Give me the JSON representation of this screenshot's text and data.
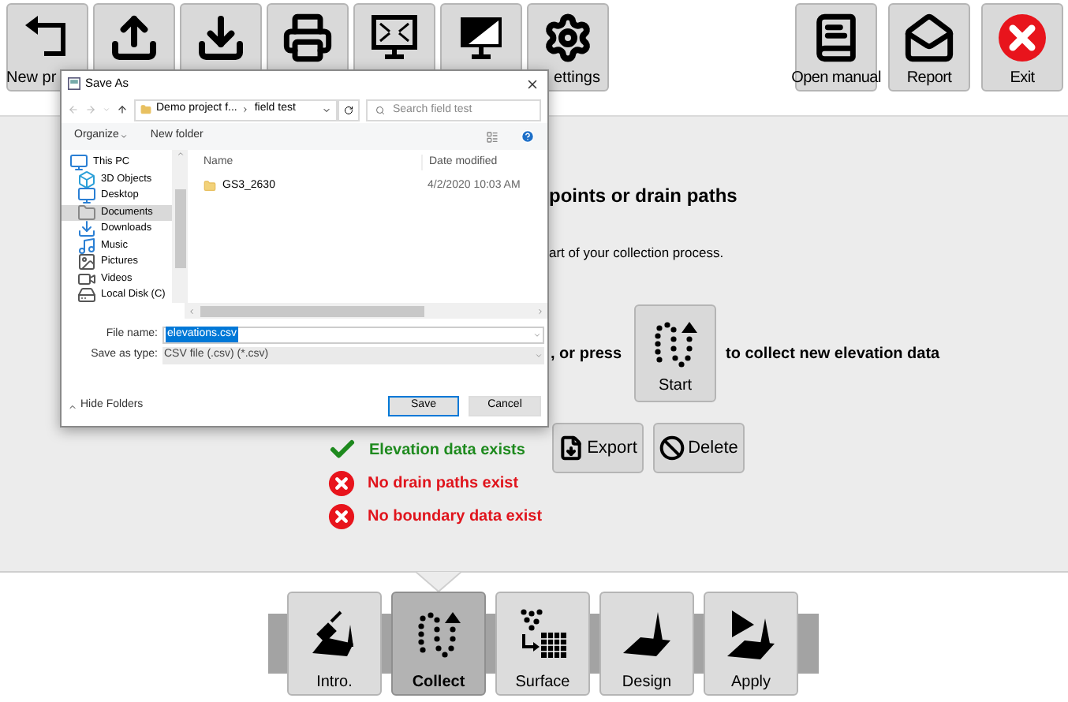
{
  "toolbar": {
    "left": [
      {
        "kind": "return",
        "label": "New pr"
      },
      {
        "kind": "upload"
      },
      {
        "kind": "download"
      },
      {
        "kind": "print"
      },
      {
        "kind": "fit-screen"
      },
      {
        "kind": "contrast"
      },
      {
        "kind": "settings",
        "label": "ettings"
      }
    ],
    "right": [
      {
        "kind": "manual",
        "label": "Open manual"
      },
      {
        "kind": "report",
        "label": "Report"
      },
      {
        "kind": "exit",
        "label": "Exit"
      }
    ]
  },
  "dialog": {
    "title": "Save As",
    "path": [
      "Demo project f...",
      "field test"
    ],
    "search_placeholder": "Search field test",
    "commands": [
      "Organize",
      "New folder"
    ],
    "nav": [
      {
        "label": "This PC",
        "selected": false
      },
      {
        "label": "3D Objects",
        "selected": false
      },
      {
        "label": "Desktop",
        "selected": false
      },
      {
        "label": "Documents",
        "selected": true
      },
      {
        "label": "Downloads",
        "selected": false
      },
      {
        "label": "Music",
        "selected": false
      },
      {
        "label": "Pictures",
        "selected": false
      },
      {
        "label": "Videos",
        "selected": false
      },
      {
        "label": "Local Disk (C)",
        "selected": false
      }
    ],
    "columns": [
      "Name",
      "Date modified"
    ],
    "files": [
      {
        "name": "GS3_2630",
        "date": "4/2/2020 10:03 AM"
      }
    ],
    "file_name_label": "File name:",
    "file_name": "elevations.csv",
    "type_label": "Save as type:",
    "type": "CSV file (.csv) (*.csv)",
    "hide_folders": "Hide Folders",
    "buttons": [
      "Save",
      "Cancel"
    ]
  },
  "main": {
    "heading": "points or drain paths",
    "subtext": "art of your collection process.",
    "prompt": ", or press",
    "start_button": "Start",
    "prompt_after": "to collect new elevation data",
    "status": [
      {
        "text": "Elevation data exists",
        "ok": true
      },
      {
        "text": "No drain paths exist",
        "ok": false
      },
      {
        "text": "No boundary data exist",
        "ok": false
      }
    ],
    "actions": [
      "Export",
      "Delete"
    ]
  },
  "steps": [
    {
      "label": "Intro.",
      "selected": false
    },
    {
      "label": "Collect",
      "selected": true
    },
    {
      "label": "Surface",
      "selected": false
    },
    {
      "label": "Design",
      "selected": false
    },
    {
      "label": "Apply",
      "selected": false
    }
  ]
}
